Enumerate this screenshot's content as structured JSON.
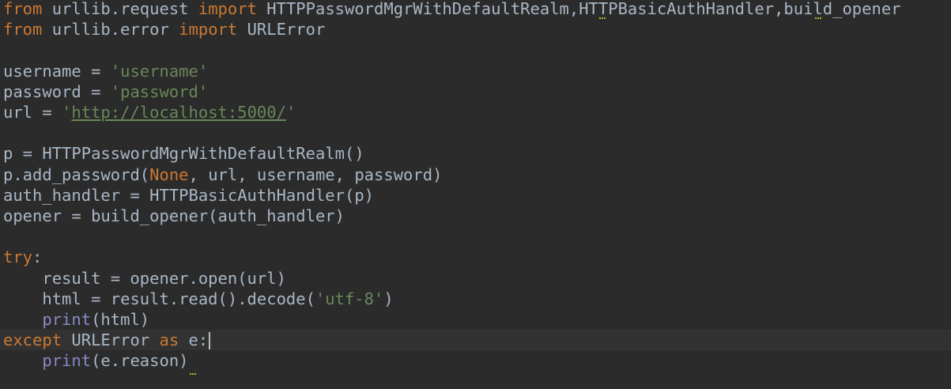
{
  "editor": {
    "lines": [
      [
        {
          "k": "kw",
          "t": "from"
        },
        {
          "k": "plain",
          "t": " urllib.request "
        },
        {
          "k": "kw",
          "t": "import"
        },
        {
          "k": "plain",
          "t": " HTTPPasswordMgrWithDefaultRealm,HTTPBasicAuthHandler,build_opener"
        }
      ],
      [
        {
          "k": "kw",
          "t": "from"
        },
        {
          "k": "plain",
          "t": " urllib.error "
        },
        {
          "k": "kw",
          "t": "import"
        },
        {
          "k": "plain",
          "t": " URLError"
        }
      ],
      [],
      [
        {
          "k": "plain",
          "t": "username = "
        },
        {
          "k": "str",
          "t": "'username'"
        }
      ],
      [
        {
          "k": "plain",
          "t": "password = "
        },
        {
          "k": "str",
          "t": "'password'"
        }
      ],
      [
        {
          "k": "plain",
          "t": "url = "
        },
        {
          "k": "str",
          "t": "'"
        },
        {
          "k": "url",
          "t": "http://localhost:5000/"
        },
        {
          "k": "str",
          "t": "'"
        }
      ],
      [],
      [
        {
          "k": "plain",
          "t": "p = HTTPPasswordMgrWithDefaultRealm()"
        }
      ],
      [
        {
          "k": "plain",
          "t": "p.add_password("
        },
        {
          "k": "kw",
          "t": "None"
        },
        {
          "k": "plain",
          "t": ", url, username, password)"
        }
      ],
      [
        {
          "k": "plain",
          "t": "auth_handler = HTTPBasicAuthHandler(p)"
        }
      ],
      [
        {
          "k": "plain",
          "t": "opener = build_opener(auth_handler)"
        }
      ],
      [],
      [
        {
          "k": "kw",
          "t": "try"
        },
        {
          "k": "plain",
          "t": ":"
        }
      ],
      [
        {
          "k": "plain",
          "t": "    result = opener.open(url)"
        }
      ],
      [
        {
          "k": "plain",
          "t": "    html = result.read().decode("
        },
        {
          "k": "str",
          "t": "'utf-8'"
        },
        {
          "k": "plain",
          "t": ")"
        }
      ],
      [
        {
          "k": "plain",
          "t": "    "
        },
        {
          "k": "bi",
          "t": "print"
        },
        {
          "k": "plain",
          "t": "(html)"
        }
      ],
      [
        {
          "k": "kw",
          "t": "except"
        },
        {
          "k": "plain",
          "t": " URLError "
        },
        {
          "k": "kw",
          "t": "as"
        },
        {
          "k": "plain",
          "t": " e:"
        }
      ],
      [
        {
          "k": "plain",
          "t": "    "
        },
        {
          "k": "bi",
          "t": "print"
        },
        {
          "k": "plain",
          "t": "(e.reason)"
        }
      ]
    ],
    "current_line": 16
  }
}
